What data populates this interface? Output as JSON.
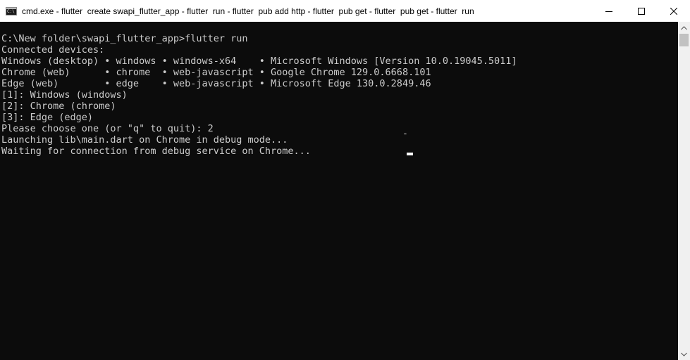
{
  "window": {
    "title": "cmd.exe - flutter  create swapi_flutter_app - flutter  run - flutter  pub add http - flutter  pub get - flutter  pub get - flutter  run",
    "icon": "cmd-console-icon",
    "controls": {
      "minimize": "minimize-icon",
      "maximize": "maximize-icon",
      "close": "close-icon"
    }
  },
  "console": {
    "lines": [
      "C:\\New folder\\swapi_flutter_app>flutter run",
      "Connected devices:",
      "Windows (desktop) • windows • windows-x64    • Microsoft Windows [Version 10.0.19045.5011]",
      "Chrome (web)      • chrome  • web-javascript • Google Chrome 129.0.6668.101",
      "Edge (web)        • edge    • web-javascript • Microsoft Edge 130.0.2849.46",
      "[1]: Windows (windows)",
      "[2]: Chrome (chrome)",
      "[3]: Edge (edge)",
      "Please choose one (or \"q\" to quit): 2",
      "Launching lib\\main.dart on Chrome in debug mode...",
      "Waiting for connection from debug service on Chrome..."
    ],
    "spinner": "-",
    "colors": {
      "background": "#0c0c0c",
      "text": "#cccccc"
    }
  }
}
